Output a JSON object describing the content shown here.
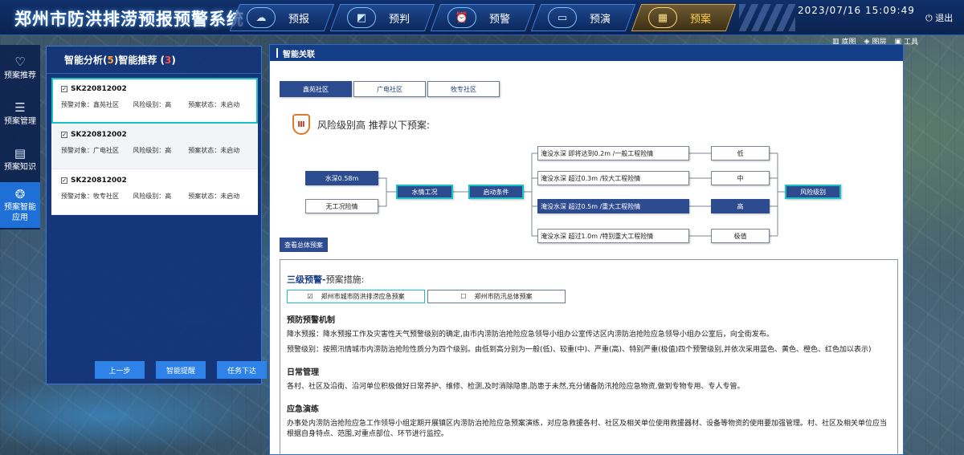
{
  "header": {
    "title": "郑州市防洪排涝预报预警系统",
    "nav": [
      {
        "label": "预报",
        "icon": "☁"
      },
      {
        "label": "预判",
        "icon": "◩"
      },
      {
        "label": "预警",
        "icon": "⏰"
      },
      {
        "label": "预演",
        "icon": "▭"
      },
      {
        "label": "预案",
        "icon": "▦"
      }
    ],
    "datetime": "2023/07/16  15:09:49",
    "exit_label": "退出"
  },
  "map": {
    "tools": [
      {
        "label": "底图",
        "icon": "▥"
      },
      {
        "label": "图层",
        "icon": "◈"
      },
      {
        "label": "工具",
        "icon": "▣"
      }
    ]
  },
  "left_nav": [
    {
      "label": "预案推荐",
      "icon": "♡"
    },
    {
      "label": "预案管理",
      "icon": "☰"
    },
    {
      "label": "预案知识",
      "icon": "▤"
    },
    {
      "label": "预案智能应用",
      "icon": "❂"
    }
  ],
  "analysis": {
    "title_prefix": "智能分析(",
    "analysis_count": "5",
    "title_mid": ")智能推荐 (",
    "recommend_count": "3",
    "title_suffix": ")",
    "cases": [
      {
        "id": "SK220812002",
        "target": "预警对象：鑫苑社区",
        "level": "风险级别：高",
        "status": "预案状态：未启动"
      },
      {
        "id": "SK220812002",
        "target": "预警对象：广电社区",
        "level": "风险级别：高",
        "status": "预案状态：未启动"
      },
      {
        "id": "SK220812002",
        "target": "预警对象：牧专社区",
        "level": "风险级别：高",
        "status": "预案状态：未启动"
      }
    ],
    "buttons": {
      "prev": "上一步",
      "remind": "智能提醒",
      "task": "任务下达"
    }
  },
  "main": {
    "title": "智能关联",
    "tabs": [
      "鑫苑社区",
      "广电社区",
      "牧专社区"
    ],
    "shield_icon": "Ⅲ",
    "risk_text": "风险级别高  推荐以下预案:",
    "flow": {
      "inputs": [
        "水深0.58m",
        "无工况险情"
      ],
      "hub1": "水情工况",
      "hub2": "启动条件",
      "conditions": [
        "淹没水深 即将达到0.2m /一般工程险情",
        "淹没水深 超过0.3m /较大工程险情",
        "淹没水深 超过0.5m /重大工程险情",
        "淹没水深 超过1.0m /特别重大工程险情"
      ],
      "levels": [
        "低",
        "中",
        "高",
        "极值"
      ],
      "output": "风险级别"
    },
    "view_button": "查看总体预案"
  },
  "plan": {
    "heading_bold": "三级预警-",
    "heading_rest": "预案措施:",
    "options": [
      {
        "label": "郑州市城市防洪排涝应急预案",
        "checked": "☑"
      },
      {
        "label": "郑州市防汛总体预案",
        "checked": "☐"
      }
    ],
    "sections": [
      {
        "title": "预防预警机制",
        "paragraphs": [
          "降水预报：降水预报工作及灾害性天气预警级别的确定,由市内涝防治抢险应急领导小组办公室传达区内涝防治抢险应急领导小组办公室后，向全街发布。",
          "预警级别：按照汛情城市内涝防治抢险性质分为四个级别。由低到高分别为一般(低)、较重(中)、严重(高)、特别严重(极值)四个预警级别,并依次采用蓝色、黄色、橙色、红色加以表示)"
        ]
      },
      {
        "title": "日常管理",
        "paragraphs": [
          "各村、社区及沿街、沿河单位积极做好日常养护、维修、检测,及时消除隐患,防患于未然,充分储备防汛抢险应急物资,做到专物专用、专人专管。"
        ]
      },
      {
        "title": "应急演练",
        "paragraphs": [
          "办事处内涝防治抢险应急工作领导小组定期开展镇区内涝防治抢险应急预案演练，对应急救援各村、社区及相关单位使用救援器材、设备等物资的使用要加强管理。村、社区及相关单位应当根据自身特点、范围,对重点部位、环节进行监控。"
        ]
      }
    ]
  },
  "colors": {
    "header": "#0b2350",
    "accent": "#2d4c8f",
    "active_nav": "#ffd24a",
    "highlight": "#18c2c7",
    "risk_icon": "#c23b22"
  }
}
